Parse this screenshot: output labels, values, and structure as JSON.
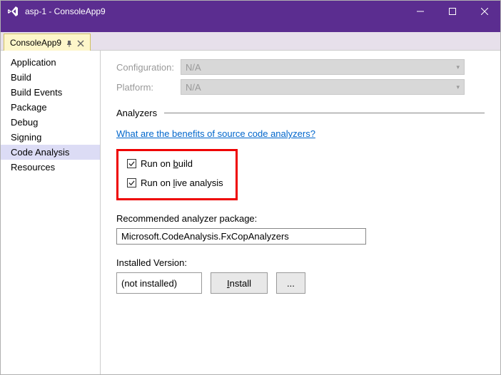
{
  "window": {
    "title": "asp-1 - ConsoleApp9"
  },
  "tab": {
    "label": "ConsoleApp9"
  },
  "sidebar": {
    "items": [
      {
        "label": "Application"
      },
      {
        "label": "Build"
      },
      {
        "label": "Build Events"
      },
      {
        "label": "Package"
      },
      {
        "label": "Debug"
      },
      {
        "label": "Signing"
      },
      {
        "label": "Code Analysis",
        "selected": true
      },
      {
        "label": "Resources"
      }
    ]
  },
  "config": {
    "configuration_label": "Configuration:",
    "configuration_value": "N/A",
    "platform_label": "Platform:",
    "platform_value": "N/A"
  },
  "section": {
    "title": "Analyzers"
  },
  "link": {
    "text": "What are the benefits of source code analyzers?"
  },
  "checkboxes": {
    "run_build_prefix": "Run on ",
    "run_build_accel": "b",
    "run_build_suffix": "uild",
    "run_live_prefix": "Run on ",
    "run_live_accel": "l",
    "run_live_suffix": "ive analysis"
  },
  "recommended": {
    "label": "Recommended analyzer package:",
    "value": "Microsoft.CodeAnalysis.FxCopAnalyzers"
  },
  "installed": {
    "label": "Installed Version:",
    "value": "(not installed)",
    "install_prefix": "",
    "install_accel": "I",
    "install_suffix": "nstall",
    "browse_label": "..."
  }
}
